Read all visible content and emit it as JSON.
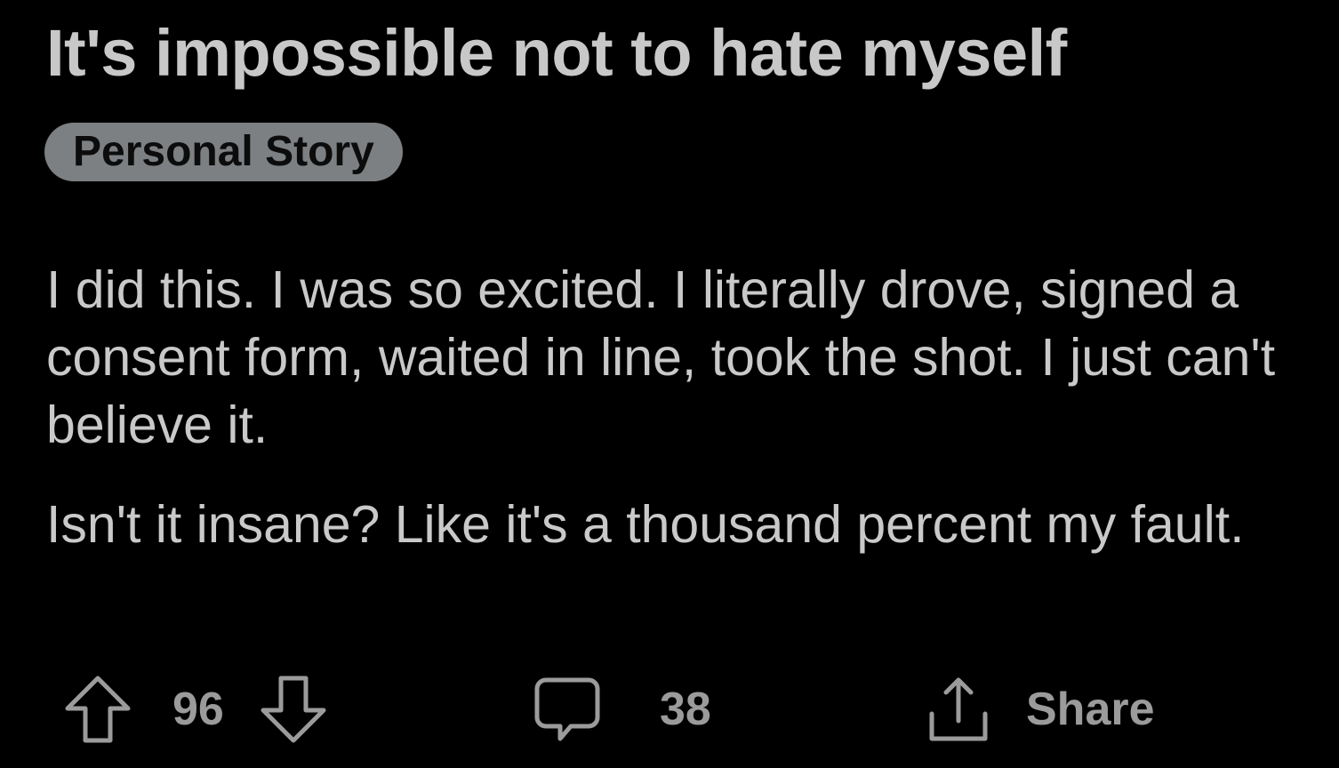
{
  "post": {
    "title": "It's impossible not to hate myself",
    "flair": "Personal Story",
    "paragraphs": [
      "I did this. I was so excited. I literally drove, signed a consent form, waited in line, took the shot. I just can't believe it.",
      "Isn't it insane? Like it's a thousand percent my fault."
    ]
  },
  "actions": {
    "upvote_icon": "upvote-arrow-icon",
    "vote_count": "96",
    "downvote_icon": "downvote-arrow-icon",
    "comment_icon": "comment-bubble-icon",
    "comment_count": "38",
    "share_icon": "share-upload-icon",
    "share_label": "Share"
  },
  "colors": {
    "background": "#000000",
    "title": "#c8c8c8",
    "body_text": "#c9c9c9",
    "flair_background": "#7c8083",
    "flair_text": "#0c0c0c",
    "action_gray": "#9b9b9b"
  }
}
